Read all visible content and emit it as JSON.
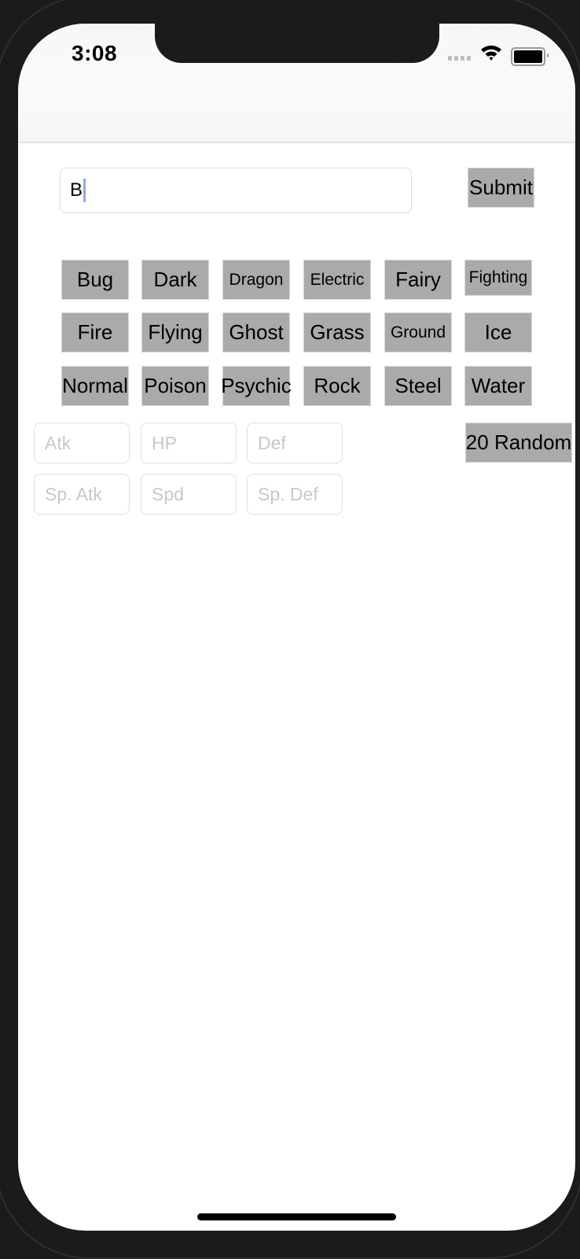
{
  "status_bar": {
    "time": "3:08",
    "signal_icon": "cellular-signal-icon",
    "wifi_icon": "wifi-icon",
    "battery_icon": "battery-icon"
  },
  "search": {
    "value": "B",
    "submit_label": "Submit"
  },
  "type_buttons": [
    {
      "label": "Bug"
    },
    {
      "label": "Dark"
    },
    {
      "label": "Dragon"
    },
    {
      "label": "Electric"
    },
    {
      "label": "Fairy"
    },
    {
      "label": "Fighting"
    },
    {
      "label": "Fire"
    },
    {
      "label": "Flying"
    },
    {
      "label": "Ghost"
    },
    {
      "label": "Grass"
    },
    {
      "label": "Ground"
    },
    {
      "label": "Ice"
    },
    {
      "label": "Normal"
    },
    {
      "label": "Poison"
    },
    {
      "label": "Psychic"
    },
    {
      "label": "Rock"
    },
    {
      "label": "Steel"
    },
    {
      "label": "Water"
    }
  ],
  "stats": {
    "atk_placeholder": "Atk",
    "hp_placeholder": "HP",
    "def_placeholder": "Def",
    "sp_atk_placeholder": "Sp. Atk",
    "spd_placeholder": "Spd",
    "sp_def_placeholder": "Sp. Def"
  },
  "random_label": "20 Random",
  "colors": {
    "button_bg": "#aaaaaa",
    "caret": "#8fa7ef",
    "placeholder": "#c8c8c8"
  }
}
